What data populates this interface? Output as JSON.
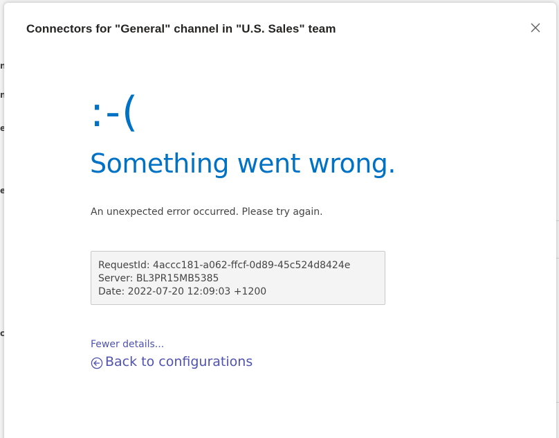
{
  "dialog": {
    "title": "Connectors for \"General\" channel in \"U.S. Sales\" team",
    "close_icon": "close-icon"
  },
  "error": {
    "face": ":-(",
    "heading": "Something went wrong.",
    "message": "An unexpected error occurred. Please try again.",
    "details": {
      "request_id": "RequestId: 4accc181-a062-ffcf-0d89-45c524d8424e",
      "server": "Server: BL3PR15MB5385",
      "date": "Date: 2022-07-20 12:09:03 +1200"
    }
  },
  "links": {
    "fewer_details": "Fewer details...",
    "back": "Back to configurations",
    "back_icon": "circle-arrow-left-icon"
  },
  "colors": {
    "accent_blue": "#0072c6",
    "link_purple": "#4f52b2",
    "text_gray": "#444444",
    "title_text": "#252423"
  }
}
